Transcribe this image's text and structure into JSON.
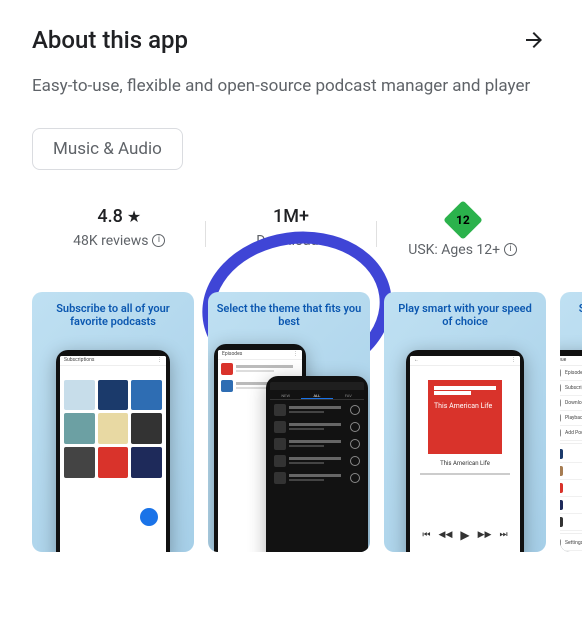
{
  "about": {
    "heading": "About this app",
    "description": "Easy-to-use, flexible and open-source podcast manager and player",
    "category_chip": "Music & Audio"
  },
  "stats": {
    "rating": {
      "value": "4.8",
      "reviews": "48K reviews"
    },
    "downloads": {
      "value": "1M+",
      "label": "Downloads"
    },
    "content_rating": {
      "badge": "12",
      "label": "USK: Ages 12+"
    }
  },
  "screenshots": [
    {
      "caption": "Subscribe to all of your favorite podcasts"
    },
    {
      "caption": "Select the theme that fits you best"
    },
    {
      "caption": "Play smart with your speed of choice"
    },
    {
      "caption": "Save time with automatic downloads"
    }
  ],
  "sample_podcast": {
    "name": "This American Life"
  },
  "phone_labels": {
    "subs": "Subscriptions",
    "episodes": "Episodes"
  }
}
